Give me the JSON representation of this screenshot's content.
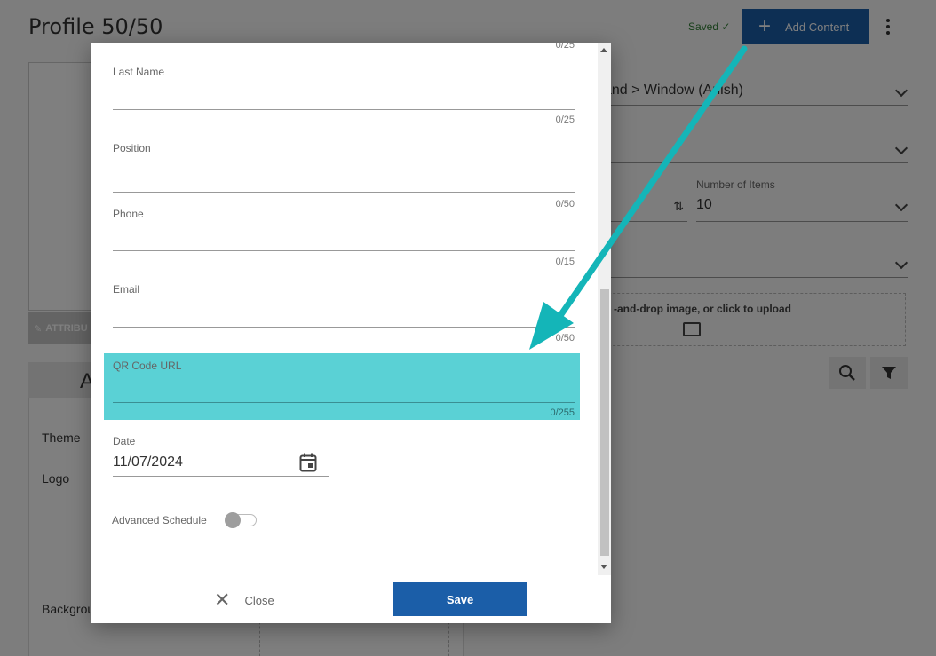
{
  "header": {
    "title": "Profile 50/50",
    "saved_status": "Saved ✓",
    "add_content_label": "Add Content"
  },
  "background": {
    "attributes_label": "ATTRIBU",
    "panel_tab_letter": "A",
    "theme_label": "Theme",
    "logo_label": "Logo",
    "background_label": "Backgrou",
    "breadcrumb_value": "and  > Window  (Anish)",
    "number_of_items_label": "Number of Items",
    "number_of_items_value": "10",
    "upload_text": "-and-drop image, or click to upload"
  },
  "modal": {
    "top_counter": "0/25",
    "fields": [
      {
        "label": "Last Name",
        "counter": "0/25",
        "value": ""
      },
      {
        "label": "Position",
        "counter": "0/50",
        "value": ""
      },
      {
        "label": "Phone",
        "counter": "0/15",
        "value": ""
      },
      {
        "label": "Email",
        "counter": "0/50",
        "value": ""
      },
      {
        "label": "QR Code URL",
        "counter": "0/255",
        "value": ""
      }
    ],
    "date_label": "Date",
    "date_value": "11/07/2024",
    "advanced_schedule_label": "Advanced Schedule",
    "advanced_schedule_on": false,
    "close_label": "Close",
    "save_label": "Save"
  },
  "colors": {
    "primary": "#1b5ea8",
    "highlight": "#5ad1d5",
    "arrow": "#14b5b8"
  }
}
